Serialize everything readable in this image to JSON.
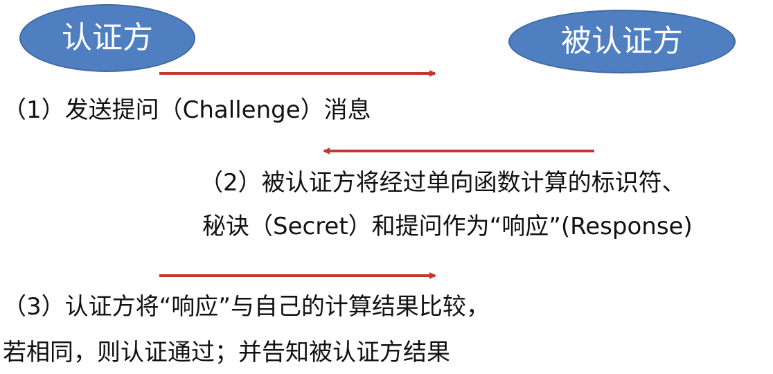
{
  "nodes": {
    "authenticator": "认证方",
    "authenticatee": "被认证方"
  },
  "steps": {
    "step1": "（1）发送提问（Challenge）消息",
    "step2_line1": "（2）被认证方将经过单向函数计算的标识符、",
    "step2_line2": "秘诀（Secret）和提问作为“响应”(Response)",
    "step3_line1": "（3）认证方将“响应”与自己的计算结果比较，",
    "step3_line2": "若相同，则认证通过；并告知被认证方结果"
  },
  "colors": {
    "node_fill": "#4f7fc1",
    "node_border": "#3f6aa1",
    "arrow": "#c0392b"
  }
}
